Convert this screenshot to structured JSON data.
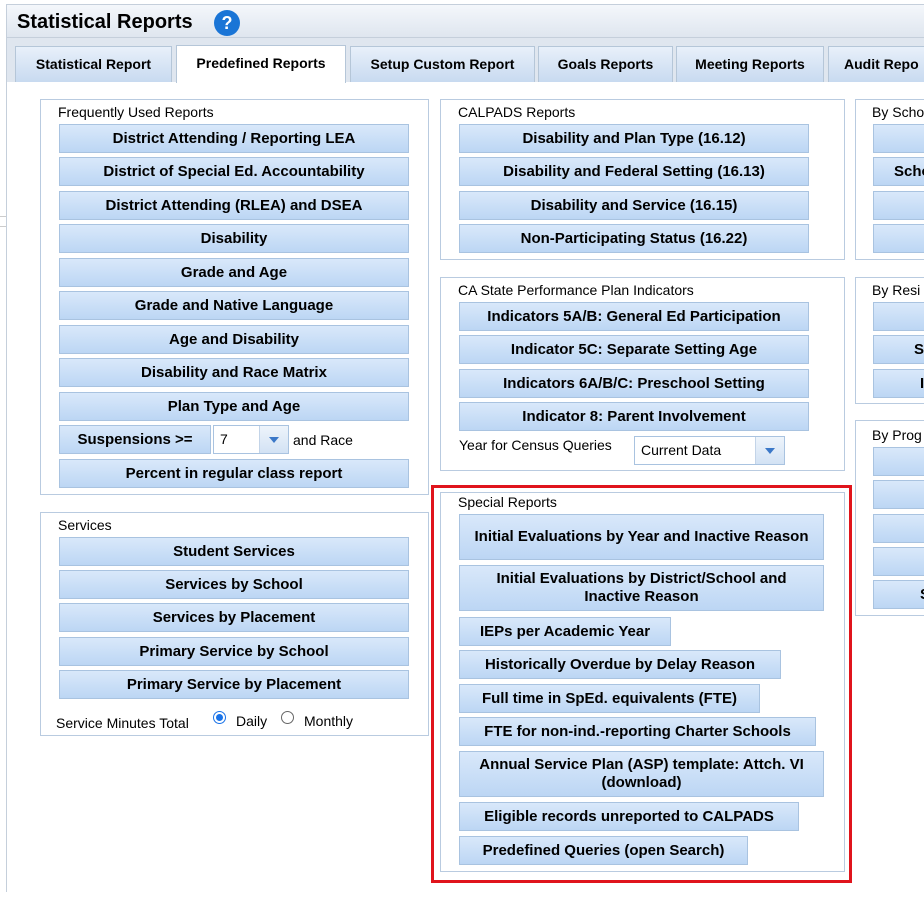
{
  "header": {
    "title": "Statistical Reports",
    "help_icon": "?"
  },
  "tabs": [
    {
      "label": "Statistical Report"
    },
    {
      "label": "Predefined Reports"
    },
    {
      "label": "Setup Custom Report"
    },
    {
      "label": "Goals Reports"
    },
    {
      "label": "Meeting Reports"
    },
    {
      "label": "Audit Repo"
    }
  ],
  "frequent": {
    "title": "Frequently Used Reports",
    "buttons": [
      "District Attending / Reporting LEA",
      "District of Special Ed. Accountability",
      "District Attending (RLEA) and DSEA",
      "Disability",
      "Grade and Age",
      "Grade and Native Language",
      "Age and Disability",
      "Disability and Race Matrix",
      "Plan Type and Age"
    ],
    "suspensions_label": "Suspensions >=",
    "suspensions_value": "7",
    "and_race": "and Race",
    "percent_button": "Percent in regular class report"
  },
  "services": {
    "title": "Services",
    "buttons": [
      "Student Services",
      "Services by School",
      "Services by Placement",
      "Primary Service by School",
      "Primary Service by Placement"
    ],
    "minutes_label": "Service Minutes Total",
    "daily": "Daily",
    "monthly": "Monthly"
  },
  "calpads": {
    "title": "CALPADS Reports",
    "buttons": [
      "Disability and Plan Type (16.12)",
      "Disability and Federal Setting (16.13)",
      "Disability and Service (16.15)",
      "Non-Participating Status (16.22)"
    ]
  },
  "spp": {
    "title": "CA State Performance Plan Indicators",
    "buttons": [
      "Indicators 5A/B: General Ed Participation",
      "Indicator 5C: Separate Setting Age",
      "Indicators 6A/B/C: Preschool Setting",
      "Indicator 8: Parent Involvement"
    ],
    "census_label": "Year for Census Queries",
    "census_value": "Current Data"
  },
  "special": {
    "title": "Special Reports",
    "buttons": [
      "Initial Evaluations by Year and Inactive Reason",
      "Initial Evaluations by District/School and Inactive Reason",
      "IEPs per Academic Year",
      "Historically Overdue by Delay Reason",
      "Full time in SpEd. equivalents (FTE)",
      "FTE for non-ind.-reporting Charter Schools",
      "Annual Service Plan (ASP) template: Attch. VI (download)",
      "Eligible records unreported to CALPADS",
      "Predefined Queries (open Search)"
    ]
  },
  "right": {
    "by_school_title": "By Scho",
    "by_school_buttons": [
      "",
      "Scho",
      "",
      ""
    ],
    "by_resi_title": "By Resi",
    "by_resi_buttons": [
      "",
      "Sc",
      "I"
    ],
    "by_prog_title": "By Prog",
    "by_prog_buttons": [
      "",
      "",
      "",
      "",
      "S"
    ]
  },
  "colors": {
    "highlight": "#e0141c",
    "button": "#c6dcf5",
    "help": "#1a75d6"
  }
}
